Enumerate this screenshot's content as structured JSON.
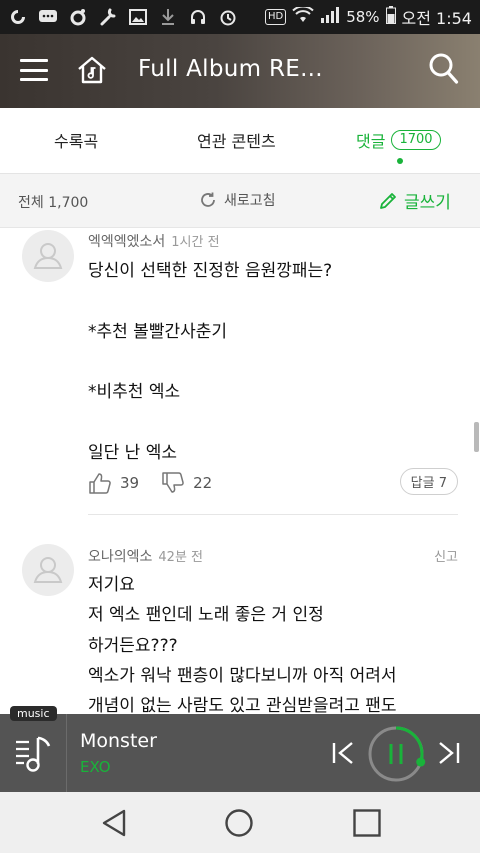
{
  "status_bar": {
    "battery_percent": "58%",
    "clock": "오전 1:54",
    "hd_label": "HD",
    "icons_left": [
      "o-app-icon",
      "chat-icon",
      "music-note-icon",
      "wrench-icon",
      "image-icon",
      "download-icon",
      "headset-icon",
      "alarm-icon"
    ],
    "icons_right": [
      "hd-icon",
      "wifi-icon",
      "signal-icon",
      "battery-icon"
    ]
  },
  "header": {
    "title": "Full Album RE..."
  },
  "tabs": [
    {
      "label": "수록곡"
    },
    {
      "label": "연관 콘텐츠"
    },
    {
      "label": "댓글",
      "count": "1700",
      "active": true
    }
  ],
  "toolbar": {
    "total": "전체 1,700",
    "refresh": "새로고침",
    "write": "글쓰기"
  },
  "comments": [
    {
      "author": "엑엑엑엤소서",
      "time": "1시간 전",
      "text": "당신이 선택한 진정한 음원깡패는?\n\n*추천 볼빨간사춘기\n\n*비추천 엑소\n\n일단 난 엑소",
      "likes": "39",
      "dislikes": "22",
      "replies": "답글 7"
    },
    {
      "author": "오나의엑소",
      "time": "42분 전",
      "report": "신고",
      "text": "저기요\n저 엑소 팬인데 노래 좋은 거 인정\n하거든요???\n엑소가 워낙 팬층이 많다보니까 아직 어려서\n개념이 없는 사람도 있고 관심받을려고 팬도"
    }
  ],
  "player": {
    "tag": "music",
    "song": "Monster",
    "artist": "EXO",
    "progress": 0.3
  },
  "colors": {
    "accent": "#19b33a",
    "player_bg": "#545454",
    "status_bg": "#1b1b1b"
  }
}
